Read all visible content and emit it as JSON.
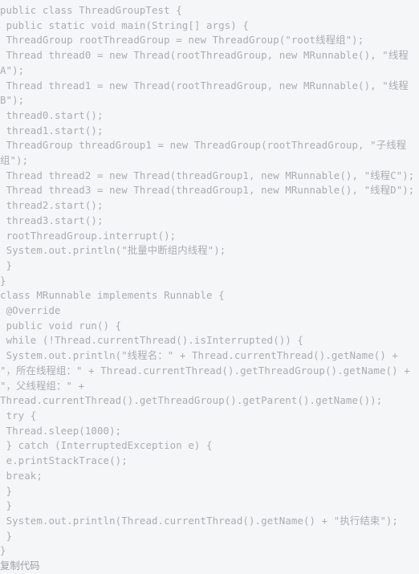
{
  "code_block": {
    "language": "java",
    "background_color": "#f5f6f7",
    "text_color": "#a9aeb3",
    "footer_color": "#9aa0a6",
    "lines": [
      "public class ThreadGroupTest {",
      " public static void main(String[] args) {",
      " ThreadGroup rootThreadGroup = new ThreadGroup(\"root线程组\");",
      " Thread thread0 = new Thread(rootThreadGroup, new MRunnable(), \"线程A\");",
      " Thread thread1 = new Thread(rootThreadGroup, new MRunnable(), \"线程B\");",
      " thread0.start();",
      " thread1.start();",
      " ThreadGroup threadGroup1 = new ThreadGroup(rootThreadGroup, \"子线程组\");",
      " Thread thread2 = new Thread(threadGroup1, new MRunnable(), \"线程C\");",
      " Thread thread3 = new Thread(threadGroup1, new MRunnable(), \"线程D\");",
      " thread2.start();",
      " thread3.start();",
      " rootThreadGroup.interrupt();",
      " System.out.println(\"批量中断组内线程\");",
      " }",
      "}",
      "class MRunnable implements Runnable {",
      " @Override",
      " public void run() {",
      " while (!Thread.currentThread().isInterrupted()) {",
      " System.out.println(\"线程名：\" + Thread.currentThread().getName() + \"，所在线程组：\" + Thread.currentThread().getThreadGroup().getName() + \"，父线程组：\" + Thread.currentThread().getThreadGroup().getParent().getName());",
      " try {",
      " Thread.sleep(1000);",
      " } catch (InterruptedException e) {",
      " e.printStackTrace();",
      " break;",
      " }",
      " }",
      " System.out.println(Thread.currentThread().getName() + \"执行结束\");",
      " }",
      "}"
    ],
    "footer": {
      "copy_label": "复制代码"
    }
  }
}
